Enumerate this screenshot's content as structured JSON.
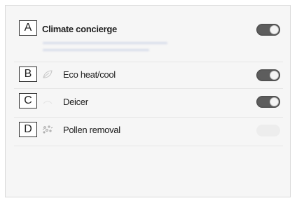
{
  "items": [
    {
      "marker": "A",
      "label": "Climate concierge",
      "icon": "none",
      "toggle_state": "on"
    },
    {
      "marker": "B",
      "label": "Eco heat/cool",
      "icon": "leaf-icon",
      "toggle_state": "on"
    },
    {
      "marker": "C",
      "label": "Deicer",
      "icon": "deicer-icon",
      "toggle_state": "on"
    },
    {
      "marker": "D",
      "label": "Pollen removal",
      "icon": "pollen-icon",
      "toggle_state": "off"
    }
  ],
  "colors": {
    "toggle_on": "#5d5d5d",
    "background": "#f6f6f6",
    "marker_border": "#333333"
  }
}
